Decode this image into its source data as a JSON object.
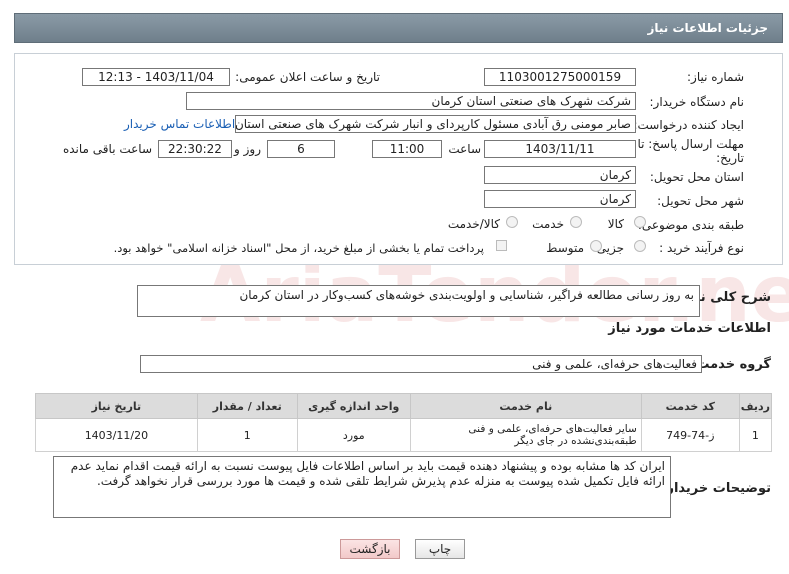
{
  "header": {
    "title": "جزئیات اطلاعات نیاز"
  },
  "form": {
    "need_number_label": "شماره نیاز:",
    "need_number": "1103001275000159",
    "announce_label": "تاریخ و ساعت اعلان عمومی:",
    "announce_value": "1403/11/04 - 12:13",
    "buyer_label": "نام دستگاه خریدار:",
    "buyer_value": "شرکت شهرک های صنعتی استان کرمان",
    "creator_label": "ایجاد کننده درخواست:",
    "creator_value": "صابر مومنی رق آبادی مسئول کارپردای و انبار شرکت شهرک های صنعتی استان کرمان",
    "contact_link": "اطلاعات تماس خریدار",
    "deadline_label_1": "مهلت ارسال پاسخ: تا",
    "deadline_label_2": "تاریخ:",
    "deadline_date": "1403/11/11",
    "time_label": "ساعت",
    "deadline_time": "11:00",
    "days_value": "6",
    "days_label": "روز و",
    "remaining_time": "22:30:22",
    "remaining_label": "ساعت باقی مانده",
    "province_label": "استان محل تحویل:",
    "province_value": "کرمان",
    "city_label": "شهر محل تحویل:",
    "city_value": "کرمان",
    "category_label": "طبقه بندی موضوعی:",
    "category_options": [
      "کالا",
      "خدمت",
      "کالا/خدمت"
    ],
    "process_label": "نوع فرآیند خرید :",
    "process_options": [
      "جزیی",
      "متوسط"
    ],
    "payment_note": "پرداخت تمام یا بخشی از مبلغ خرید، از محل \"اسناد خزانه اسلامی\" خواهد بود."
  },
  "summary": {
    "label": "شرح کلی نیاز:",
    "value": "به روز رسانی مطالعه فراگیر، شناسایی و اولویت‌بندی خوشه‌های کسب‌وکار در استان کرمان"
  },
  "services": {
    "section_title": "اطلاعات خدمات مورد نیاز",
    "group_label": "گروه خدمت:",
    "group_value": "فعالیت‌های حرفه‌ای، علمی و فنی",
    "columns": [
      "ردیف",
      "کد خدمت",
      "نام خدمت",
      "واحد اندازه گیری",
      "تعداد / مقدار",
      "تاریخ نیاز"
    ],
    "rows": [
      [
        "1",
        "ز-74-749",
        "سایر فعالیت‌های حرفه‌ای، علمی و فنی طبقه‌بندی‌نشده در جای دیگر",
        "مورد",
        "1",
        "1403/11/20"
      ]
    ]
  },
  "notes": {
    "label": "توضیحات خریدار:",
    "value": "ایران کد ها مشابه بوده و پیشنهاد دهنده قیمت باید بر اساس اطلاعات فایل پیوست نسبت به ارائه قیمت اقدام نماید عدم ارائه فایل تکمیل شده پیوست به منزله عدم پذیرش شرایط تلقی شده و قیمت ها مورد بررسی قرار نخواهد گرفت."
  },
  "buttons": {
    "print": "چاپ",
    "back": "بازگشت"
  },
  "watermark": "AriaTender.neT"
}
